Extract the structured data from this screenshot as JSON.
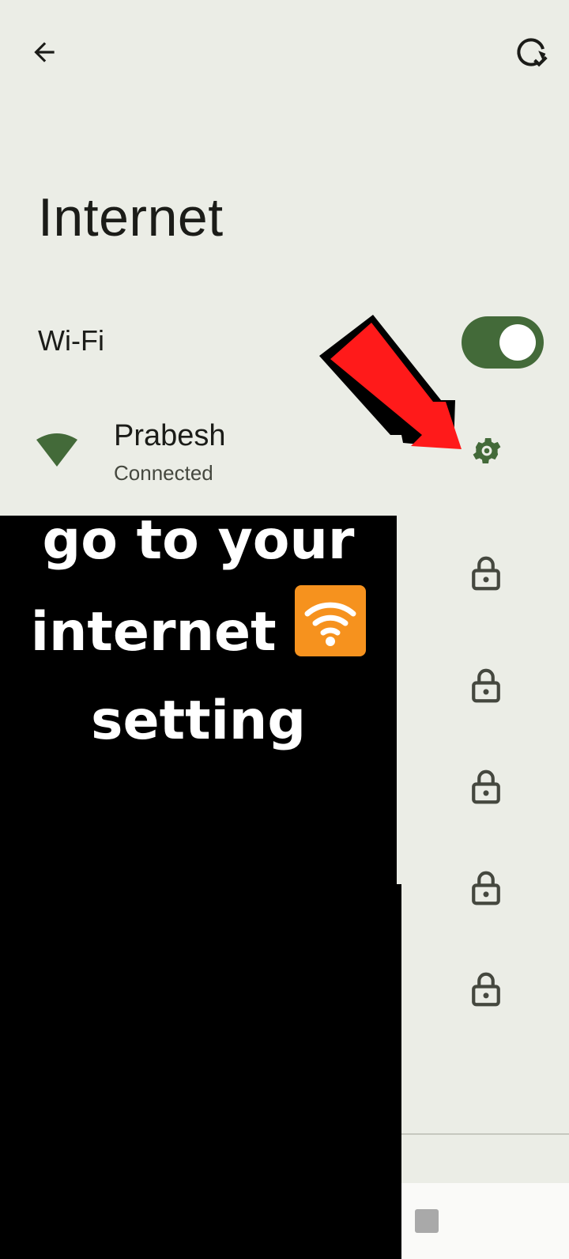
{
  "header": {
    "back_icon": "arrow-back-icon",
    "reset_icon": "network-reset-icon"
  },
  "page": {
    "title": "Internet"
  },
  "wifi": {
    "label": "Wi-Fi",
    "enabled": true,
    "toggle_color": "#436a39"
  },
  "connected_network": {
    "name": "Prabesh",
    "status": "Connected",
    "signal_icon": "wifi-signal-icon",
    "settings_icon": "gear-icon"
  },
  "other_networks": [
    {
      "icon": "lock-icon"
    },
    {
      "icon": "lock-icon"
    },
    {
      "icon": "lock-icon"
    },
    {
      "icon": "lock-icon"
    },
    {
      "icon": "lock-icon"
    }
  ],
  "overlay": {
    "line1": "go to your",
    "line2": "internet",
    "line3": "setting",
    "emoji": "wifi-emoji",
    "arrow": "red-arrow-annotation",
    "arrow_color": "#ff0000"
  },
  "colors": {
    "accent": "#436a39",
    "background": "#ebede6"
  }
}
